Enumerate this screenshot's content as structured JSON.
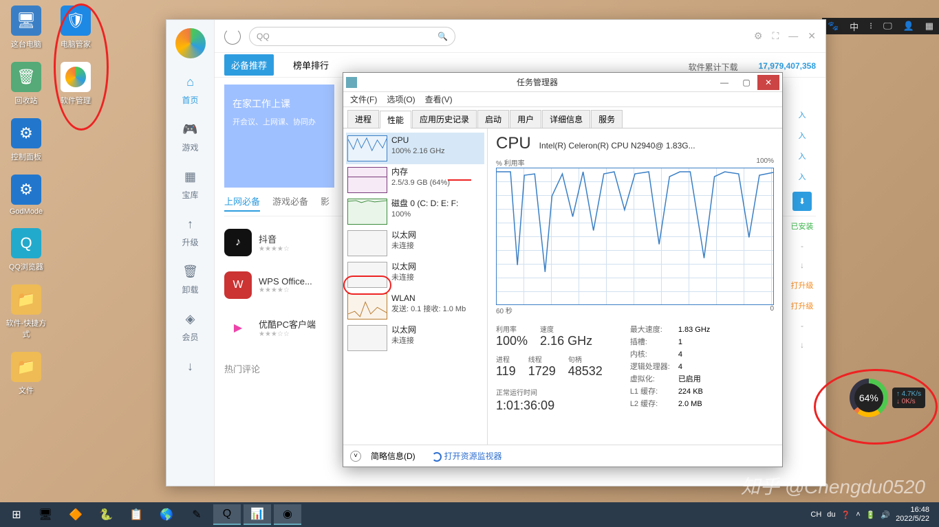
{
  "desktop": {
    "col1": [
      "这台电脑",
      "回收站",
      "控制面板",
      "GodMode",
      "QQ浏览器",
      "软件-快捷方式",
      "文件"
    ],
    "col2": [
      "电脑管家",
      "软件管理"
    ]
  },
  "topbar": [
    "🐾",
    "中",
    "⁝",
    "🖵",
    "👤",
    "▦"
  ],
  "swmgr": {
    "search_placeholder": "QQ",
    "sidebar": [
      {
        "icon": "⌂",
        "label": "首页"
      },
      {
        "icon": "🎮",
        "label": "游戏"
      },
      {
        "icon": "▦",
        "label": "宝库"
      },
      {
        "icon": "↑",
        "label": "升级"
      },
      {
        "icon": "🗑",
        "label": "卸载"
      },
      {
        "icon": "◈",
        "label": "会员"
      },
      {
        "icon": "↓",
        "label": ""
      }
    ],
    "tabs": {
      "primary": "必备推荐",
      "second": "榜单排行"
    },
    "stats_label": "软件累计下载",
    "stats_value": "17,979,407,358",
    "banner": {
      "title": "在家工作上课",
      "sub": "开会议、上网课、协同办"
    },
    "subtabs": [
      "上网必备",
      "游戏必备",
      "影"
    ],
    "apps": [
      {
        "name": "抖音",
        "color": "#111"
      },
      {
        "name": "WPS Office...",
        "color": "#d94"
      },
      {
        "name": "优酷PC客户端",
        "color": "#e4a"
      }
    ],
    "hot": "热门评论",
    "right_items": [
      "入",
      "入",
      "入",
      "入",
      "已安装",
      "-",
      "↓",
      "打升级",
      "打升级",
      "-",
      "↓"
    ]
  },
  "taskmgr": {
    "title": "任务管理器",
    "menu": [
      "文件(F)",
      "选项(O)",
      "查看(V)"
    ],
    "tabs": [
      "进程",
      "性能",
      "应用历史记录",
      "启动",
      "用户",
      "详细信息",
      "服务"
    ],
    "active_tab": 1,
    "left": [
      {
        "name": "CPU",
        "detail": "100%  2.16 GHz",
        "kind": "cpu"
      },
      {
        "name": "内存",
        "detail": "2.5/3.9 GB (64%)",
        "kind": "mem"
      },
      {
        "name": "磁盘 0 (C: D: E: F:",
        "detail": "100%",
        "kind": "disk"
      },
      {
        "name": "以太网",
        "detail": "未连接",
        "kind": "empty"
      },
      {
        "name": "以太网",
        "detail": "未连接",
        "kind": "empty"
      },
      {
        "name": "WLAN",
        "detail": "发送: 0.1  接收: 1.0 Mb",
        "kind": "net"
      },
      {
        "name": "以太网",
        "detail": "未连接",
        "kind": "empty"
      }
    ],
    "cpu_title": "CPU",
    "cpu_model": "Intel(R) Celeron(R) CPU N2940@ 1.83G...",
    "graph_top_l": "% 利用率",
    "graph_top_r": "100%",
    "graph_bot_l": "60 秒",
    "graph_bot_r": "0",
    "util_l": "利用率",
    "util_v": "100%",
    "speed_l": "速度",
    "speed_v": "2.16 GHz",
    "proc_l": "进程",
    "proc_v": "119",
    "thr_l": "线程",
    "thr_v": "1729",
    "hnd_l": "句柄",
    "hnd_v": "48532",
    "kv": [
      {
        "k": "最大速度:",
        "v": "1.83 GHz"
      },
      {
        "k": "插槽:",
        "v": "1"
      },
      {
        "k": "内核:",
        "v": "4"
      },
      {
        "k": "逻辑处理器:",
        "v": "4"
      },
      {
        "k": "虚拟化:",
        "v": "已启用"
      },
      {
        "k": "L1 缓存:",
        "v": "224 KB"
      },
      {
        "k": "L2 缓存:",
        "v": "2.0 MB"
      }
    ],
    "uptime_l": "正常运行时间",
    "uptime_v": "1:01:36:09",
    "foot_brief": "简略信息(D)",
    "foot_res": "打开资源监视器"
  },
  "sysmon": {
    "pct": "64%",
    "up": "↑ 4.7K/s",
    "dn": "↓ 0K/s"
  },
  "taskbar": {
    "time": "16:48",
    "date": "2022/5/22",
    "ime": "CH"
  },
  "watermark": "知乎 @Chengdu0520"
}
